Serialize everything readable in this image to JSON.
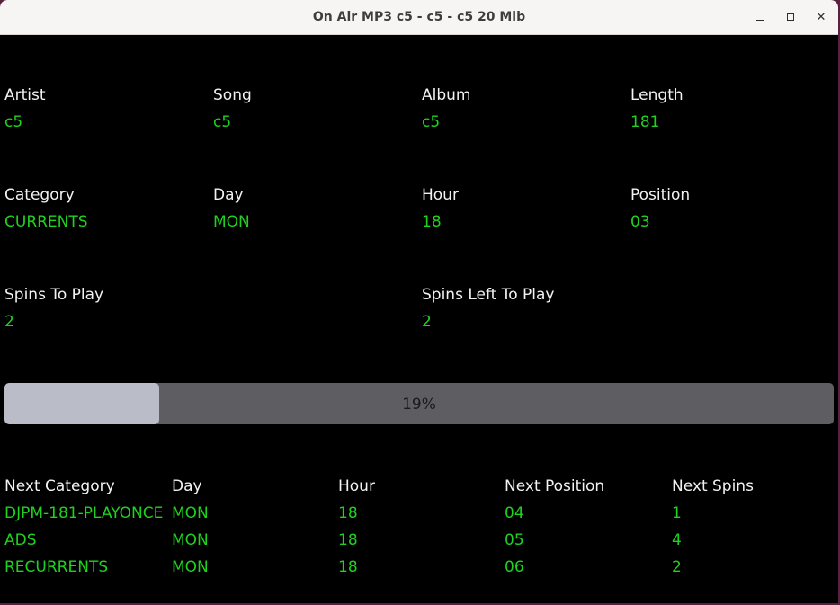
{
  "window": {
    "title": "On Air MP3 c5 - c5 - c5 20 Mib",
    "min_icon": "minimize-icon",
    "max_icon": "maximize-icon",
    "close_icon": "close-icon",
    "close_glyph": "✕"
  },
  "now_playing": {
    "artist_label": "Artist",
    "artist": "c5",
    "song_label": "Song",
    "song": "c5",
    "album_label": "Album",
    "album": "c5",
    "length_label": "Length",
    "length": "181",
    "category_label": "Category",
    "category": "CURRENTS",
    "day_label": "Day",
    "day": "MON",
    "hour_label": "Hour",
    "hour": "18",
    "position_label": "Position",
    "position": "03",
    "spins_to_play_label": "Spins To Play",
    "spins_to_play": "2",
    "spins_left_label": "Spins Left To Play",
    "spins_left": "2"
  },
  "progress": {
    "percent": 19,
    "text": "19%"
  },
  "next": {
    "headers": [
      "Next Category",
      "Day",
      "Hour",
      "Next Position",
      "Next Spins"
    ],
    "rows": [
      [
        "DJPM-181-PLAYONCE",
        "MON",
        "18",
        "04",
        "1"
      ],
      [
        "ADS",
        "MON",
        "18",
        "05",
        "4"
      ],
      [
        "RECURRENTS",
        "MON",
        "18",
        "06",
        "2"
      ]
    ]
  },
  "colors": {
    "label": "#f2f2f2",
    "value": "#1fd21f",
    "progress_track": "#5e5e62",
    "progress_fill": "#babcc8"
  }
}
